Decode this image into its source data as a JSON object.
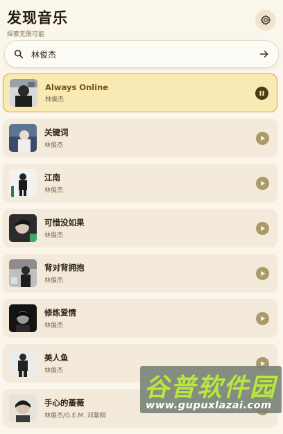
{
  "header": {
    "title": "发现音乐",
    "subtitle": "探索无限可能",
    "settings_icon": "gear-icon"
  },
  "search": {
    "value": "林俊杰",
    "placeholder": "",
    "search_icon": "search-icon",
    "submit_icon": "arrow-right-icon"
  },
  "songs": [
    {
      "title": "Always Online",
      "artist": "林俊杰",
      "state": "playing",
      "icon": "pause-icon"
    },
    {
      "title": "关键词",
      "artist": "林俊杰",
      "state": "paused",
      "icon": "play-icon"
    },
    {
      "title": "江南",
      "artist": "林俊杰",
      "state": "paused",
      "icon": "play-icon"
    },
    {
      "title": "可惜没如果",
      "artist": "林俊杰",
      "state": "paused",
      "icon": "play-icon"
    },
    {
      "title": "背对背拥抱",
      "artist": "林俊杰",
      "state": "paused",
      "icon": "play-icon"
    },
    {
      "title": "修炼爱情",
      "artist": "林俊杰",
      "state": "paused",
      "icon": "play-icon"
    },
    {
      "title": "美人鱼",
      "artist": "林俊杰",
      "state": "paused",
      "icon": "play-icon"
    },
    {
      "title": "手心的蔷薇",
      "artist": "林俊杰/G.E.M. 邓紫棋",
      "state": "paused",
      "icon": "play-icon"
    }
  ],
  "watermark": {
    "title": "谷普软件园",
    "url": "www.gupuxlazai.com"
  },
  "colors": {
    "background": "#fbf6ec",
    "active_item": "#f9e9b3",
    "active_border": "#c9a84f",
    "item": "#f3eadb",
    "play_button": "#a99a6a",
    "pause_button": "#4a3c12"
  }
}
